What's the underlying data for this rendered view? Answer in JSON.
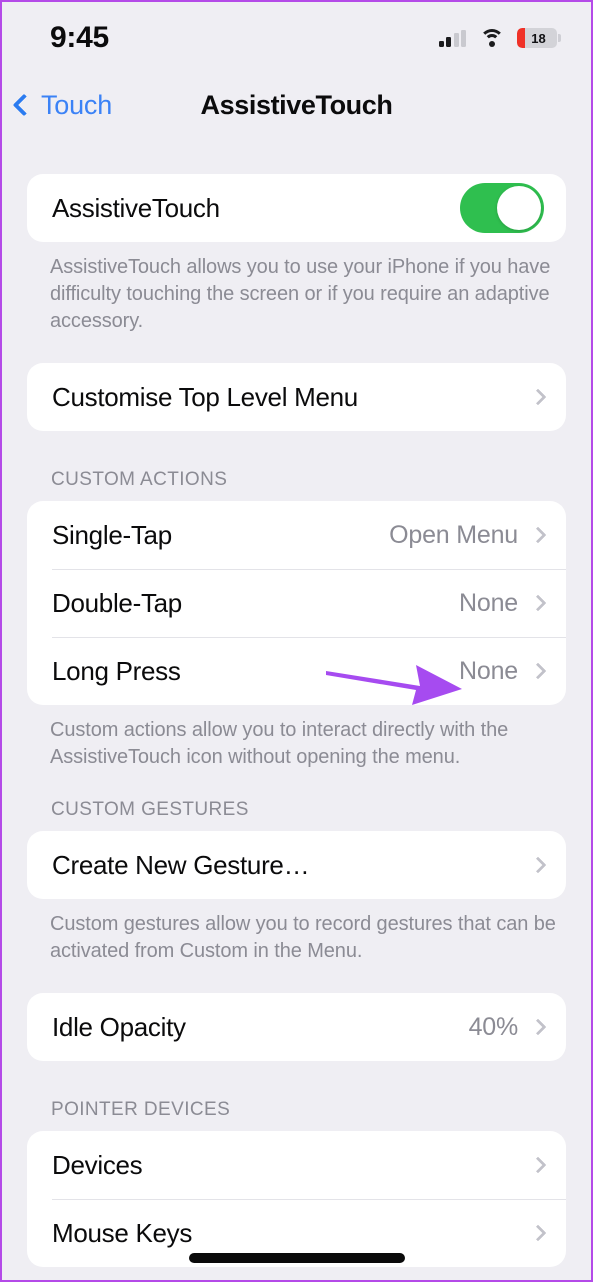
{
  "status_bar": {
    "time": "9:45",
    "signal_icon": "cellular-signal-icon",
    "wifi_icon": "wifi-icon",
    "battery_level": "18",
    "battery_icon": "battery-icon"
  },
  "nav": {
    "back_label": "Touch",
    "back_icon": "chevron-left-icon",
    "title": "AssistiveTouch"
  },
  "sections": {
    "main_toggle": {
      "label": "AssistiveTouch",
      "enabled": true,
      "footer": "AssistiveTouch allows you to use your iPhone if you have difficulty touching the screen or if you require an adaptive accessory."
    },
    "customise_menu": {
      "label": "Customise Top Level Menu"
    },
    "custom_actions": {
      "header": "CUSTOM ACTIONS",
      "rows": [
        {
          "label": "Single-Tap",
          "value": "Open Menu"
        },
        {
          "label": "Double-Tap",
          "value": "None"
        },
        {
          "label": "Long Press",
          "value": "None"
        }
      ],
      "footer": "Custom actions allow you to interact directly with the AssistiveTouch icon without opening the menu."
    },
    "custom_gestures": {
      "header": "CUSTOM GESTURES",
      "rows": [
        {
          "label": "Create New Gesture…"
        }
      ],
      "footer": "Custom gestures allow you to record gestures that can be activated from Custom in the Menu."
    },
    "idle_opacity": {
      "label": "Idle Opacity",
      "value": "40%"
    },
    "pointer_devices": {
      "header": "POINTER DEVICES",
      "rows": [
        {
          "label": "Devices"
        },
        {
          "label": "Mouse Keys"
        }
      ]
    }
  },
  "annotation": {
    "arrow_icon": "annotation-arrow-right",
    "color": "#a64bf0",
    "points_at": "Long Press value"
  },
  "colors": {
    "page_background": "#efeef3",
    "card_background": "#ffffff",
    "accent_blue": "#3b82f6",
    "toggle_green": "#2fbf4f",
    "secondary_text": "#8b8b94",
    "frame_border": "#b44ae8",
    "battery_low": "#f03127"
  }
}
